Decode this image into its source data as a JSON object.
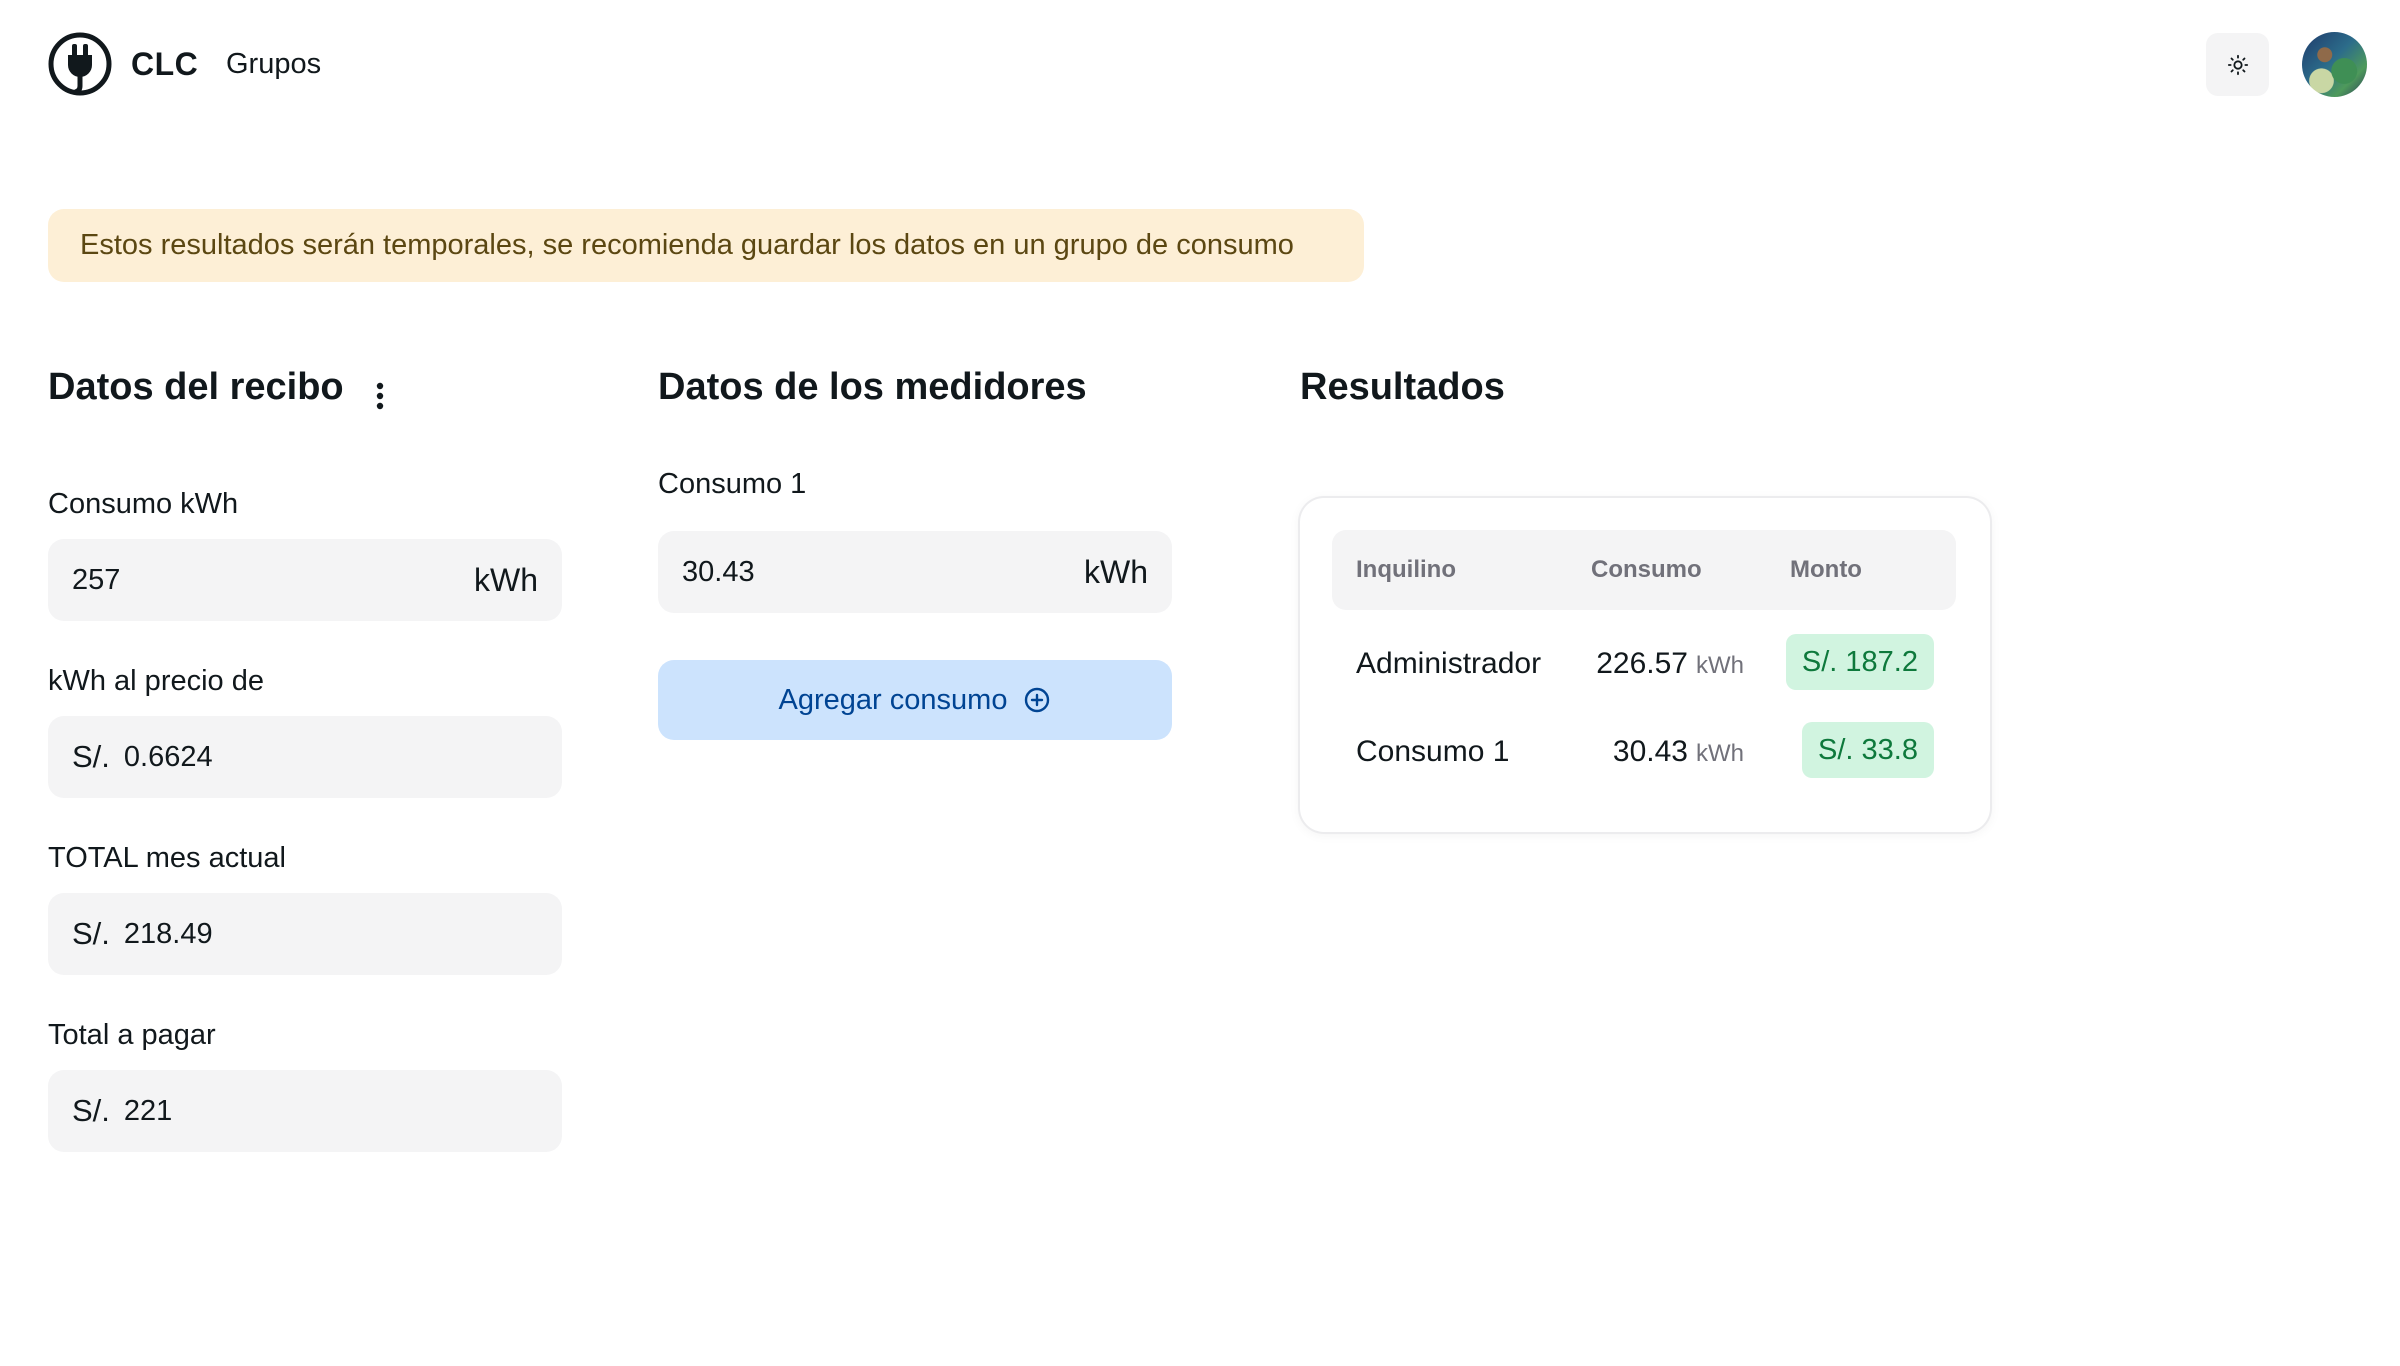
{
  "header": {
    "brand": "CLC",
    "nav_link": "Grupos",
    "theme_toggle_icon": "sun-icon",
    "avatar_icon": "user-avatar"
  },
  "alert": {
    "text": "Estos resultados serán temporales, se recomienda guardar los datos en un grupo de consumo",
    "color": "#fdefd6"
  },
  "receipt": {
    "title": "Datos del recibo",
    "menu_icon": "vertical-dots-icon",
    "fields": [
      {
        "label": "Consumo kWh",
        "value": "257",
        "prefix": "",
        "suffix": "kWh"
      },
      {
        "label": "kWh al precio de",
        "value": "0.6624",
        "prefix": "S/.",
        "suffix": ""
      },
      {
        "label": "TOTAL mes actual",
        "value": "218.49",
        "prefix": "S/.",
        "suffix": ""
      },
      {
        "label": "Total a pagar",
        "value": "221",
        "prefix": "S/.",
        "suffix": ""
      }
    ]
  },
  "meters": {
    "title": "Datos de los medidores",
    "items": [
      {
        "label": "Consumo 1",
        "value": "30.43",
        "suffix": "kWh"
      }
    ],
    "add_button": "Agregar consumo",
    "add_icon": "plus-circle-icon"
  },
  "results": {
    "title": "Resultados",
    "columns": [
      "Inquilino",
      "Consumo",
      "Monto"
    ],
    "rows": [
      {
        "tenant": "Administrador",
        "consumption": "226.57",
        "unit": "kWh",
        "amount": "S/. 187.2"
      },
      {
        "tenant": "Consumo 1",
        "consumption": "30.43",
        "unit": "kWh",
        "amount": "S/. 33.8"
      }
    ],
    "chip_color": "#d1f4e0"
  }
}
